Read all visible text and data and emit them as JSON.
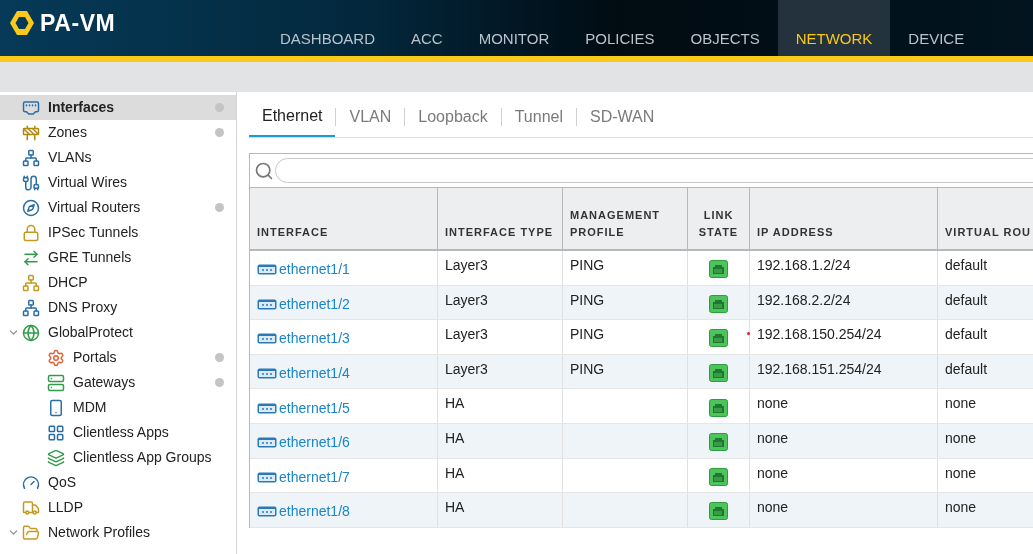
{
  "header": {
    "product": "PA-VM",
    "nav": [
      {
        "label": "DASHBOARD",
        "selected": false
      },
      {
        "label": "ACC",
        "selected": false
      },
      {
        "label": "MONITOR",
        "selected": false
      },
      {
        "label": "POLICIES",
        "selected": false
      },
      {
        "label": "OBJECTS",
        "selected": false
      },
      {
        "label": "NETWORK",
        "selected": true
      },
      {
        "label": "DEVICE",
        "selected": false
      }
    ]
  },
  "sidebar": {
    "items": [
      {
        "label": "Interfaces",
        "selected": true,
        "marked": true
      },
      {
        "label": "Zones",
        "selected": false,
        "marked": true
      },
      {
        "label": "VLANs",
        "selected": false,
        "marked": false
      },
      {
        "label": "Virtual Wires",
        "selected": false,
        "marked": false
      },
      {
        "label": "Virtual Routers",
        "selected": false,
        "marked": true
      },
      {
        "label": "IPSec Tunnels",
        "selected": false,
        "marked": false
      },
      {
        "label": "GRE Tunnels",
        "selected": false,
        "marked": false
      },
      {
        "label": "DHCP",
        "selected": false,
        "marked": false
      },
      {
        "label": "DNS Proxy",
        "selected": false,
        "marked": false
      },
      {
        "label": "GlobalProtect",
        "selected": false,
        "marked": false,
        "expanded": true,
        "children": [
          {
            "label": "Portals",
            "selected": false,
            "marked": true
          },
          {
            "label": "Gateways",
            "selected": false,
            "marked": true
          },
          {
            "label": "MDM",
            "selected": false,
            "marked": false
          },
          {
            "label": "Clientless Apps",
            "selected": false,
            "marked": false
          },
          {
            "label": "Clientless App Groups",
            "selected": false,
            "marked": false
          }
        ]
      },
      {
        "label": "QoS",
        "selected": false,
        "marked": false
      },
      {
        "label": "LLDP",
        "selected": false,
        "marked": false
      },
      {
        "label": "Network Profiles",
        "selected": false,
        "marked": false,
        "expanded": true
      }
    ]
  },
  "tabs": [
    {
      "label": "Ethernet",
      "selected": true
    },
    {
      "label": "VLAN",
      "selected": false
    },
    {
      "label": "Loopback",
      "selected": false
    },
    {
      "label": "Tunnel",
      "selected": false
    },
    {
      "label": "SD-WAN",
      "selected": false
    }
  ],
  "table": {
    "columns": [
      "INTERFACE",
      "INTERFACE TYPE",
      "MANAGEMENT PROFILE",
      "LINK STATE",
      "IP ADDRESS",
      "VIRTUAL ROU"
    ],
    "rows": [
      {
        "interface": "ethernet1/1",
        "type": "Layer3",
        "profile": "PING",
        "link_up": true,
        "warning": false,
        "ip": "192.168.1.2/24",
        "router": "default"
      },
      {
        "interface": "ethernet1/2",
        "type": "Layer3",
        "profile": "PING",
        "link_up": true,
        "warning": false,
        "ip": "192.168.2.2/24",
        "router": "default"
      },
      {
        "interface": "ethernet1/3",
        "type": "Layer3",
        "profile": "PING",
        "link_up": true,
        "warning": true,
        "ip": "192.168.150.254/24",
        "router": "default"
      },
      {
        "interface": "ethernet1/4",
        "type": "Layer3",
        "profile": "PING",
        "link_up": true,
        "warning": false,
        "ip": "192.168.151.254/24",
        "router": "default"
      },
      {
        "interface": "ethernet1/5",
        "type": "HA",
        "link_up": true,
        "warning": false,
        "ip": "none",
        "router": "none"
      },
      {
        "interface": "ethernet1/6",
        "type": "HA",
        "link_up": true,
        "warning": false,
        "ip": "none",
        "router": "none"
      },
      {
        "interface": "ethernet1/7",
        "type": "HA",
        "link_up": true,
        "warning": false,
        "ip": "none",
        "router": "none"
      },
      {
        "interface": "ethernet1/8",
        "type": "HA",
        "link_up": true,
        "warning": false,
        "ip": "none",
        "router": "none"
      }
    ]
  }
}
